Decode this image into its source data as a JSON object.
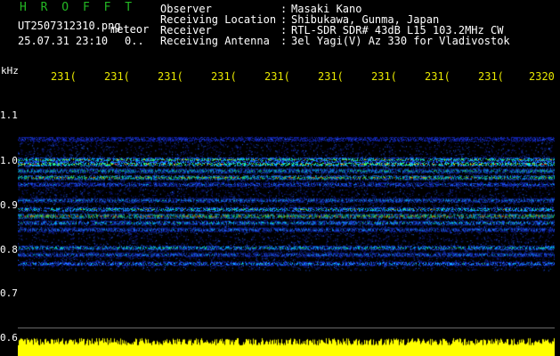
{
  "colors": {
    "brand": "#24b824",
    "header_text": "#ffffff",
    "tick_text": "#e8e800",
    "yaxis_text": "#ffffff",
    "background": "#000000",
    "noise_fill": "#ffff00"
  },
  "header": {
    "brand": "H R O F F T",
    "filename": "UT2507312310.png",
    "detection_type": "meteor",
    "timestamp": "25.07.31 23:10",
    "percent": "0..",
    "fields": [
      {
        "label": "Observer",
        "sep": ":",
        "value": "Masaki Kano"
      },
      {
        "label": "Receiving Location",
        "sep": ":",
        "value": "Shibukawa, Gunma, Japan"
      },
      {
        "label": "Receiver",
        "sep": ":",
        "value": "RTL-SDR SDR# 43dB L15 103.2MHz CW"
      },
      {
        "label": "Receiving Antenna",
        "sep": ":",
        "value": "3el Yagi(V) Az 330 for Vladivostok"
      }
    ]
  },
  "axis": {
    "y_unit": "kHz",
    "y_ticks": [
      "1.1",
      "1.0",
      "0.9",
      "0.8",
      "0.7",
      "0.6"
    ],
    "y_values": [
      1.1,
      1.0,
      0.9,
      0.8,
      0.7,
      0.6
    ],
    "x_ticks": [
      "231(",
      "231(",
      "231(",
      "231(",
      "231(",
      "231(",
      "231(",
      "231(",
      "231(",
      "2320"
    ]
  },
  "spectrogram": {
    "freq_range": [
      0.6,
      1.15
    ],
    "bands_khz": [
      1.04,
      0.995,
      0.985,
      0.97,
      0.955,
      0.94,
      0.905,
      0.885,
      0.87,
      0.855,
      0.84,
      0.8,
      0.785,
      0.765
    ],
    "intensity": [
      0.35,
      0.8,
      0.9,
      0.7,
      0.85,
      0.5,
      0.6,
      0.75,
      0.95,
      0.65,
      0.55,
      0.7,
      0.55,
      0.6
    ]
  }
}
